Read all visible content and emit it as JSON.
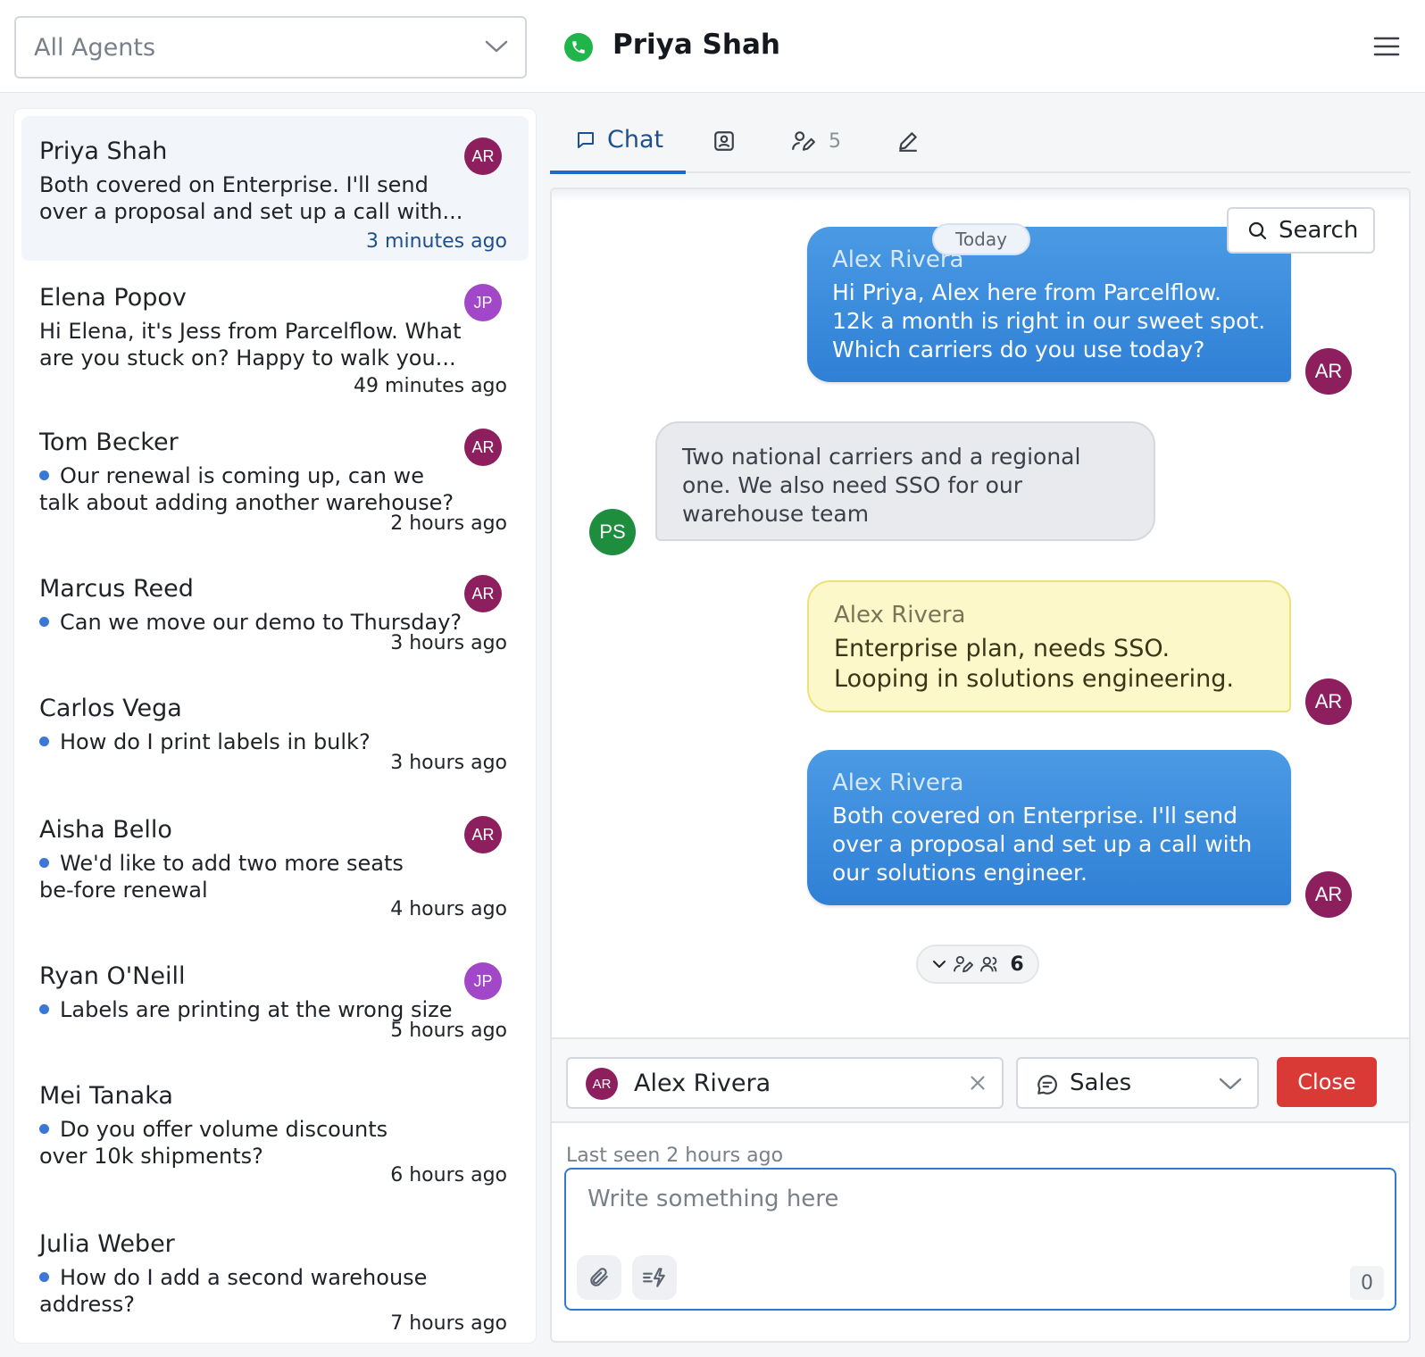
{
  "header": {
    "agent_filter": "All Agents",
    "contact_name": "Priya Shah"
  },
  "conversations": [
    {
      "name": "Priya Shah",
      "preview": "Both covered on Enterprise. I'll send over a proposal and set up a call with...",
      "time": "3 minutes ago",
      "avatar": "AR",
      "unread": false
    },
    {
      "name": "Elena Popov",
      "preview": "Hi Elena, it's Jess from Parcelflow. What are you stuck on? Happy to walk you...",
      "time": "49 minutes ago",
      "avatar": "JP",
      "unread": false
    },
    {
      "name": "Tom Becker",
      "preview": "Our renewal is coming up, can we talk about adding another warehouse?",
      "time": "2 hours ago",
      "avatar": "AR",
      "unread": true
    },
    {
      "name": "Marcus Reed",
      "preview": "Can we move our demo to Thursday?",
      "time": "3 hours ago",
      "avatar": "AR",
      "unread": true
    },
    {
      "name": "Carlos Vega",
      "preview": "How do I print labels in bulk?",
      "time": "3 hours ago",
      "avatar": "",
      "unread": true
    },
    {
      "name": "Aisha Bello",
      "preview": "We'd like to add two more seats be-fore renewal",
      "time": "4 hours ago",
      "avatar": "AR",
      "unread": true
    },
    {
      "name": "Ryan O'Neill",
      "preview": "Labels are printing at the wrong size",
      "time": "5 hours ago",
      "avatar": "JP",
      "unread": true
    },
    {
      "name": "Mei Tanaka",
      "preview": "Do you offer volume discounts over 10k shipments?",
      "time": "6 hours ago",
      "avatar": "",
      "unread": true
    },
    {
      "name": "Julia Weber",
      "preview": "How do I add a second warehouse address?",
      "time": "7 hours ago",
      "avatar": "",
      "unread": true
    }
  ],
  "tabs": {
    "chat_label": "Chat",
    "participants_count": "5"
  },
  "chat": {
    "date_divider": "Today",
    "search_label": "Search",
    "messages": [
      {
        "type": "agent",
        "sender": "Alex Rivera",
        "text": "Hi Priya, Alex here from Parcelflow. 12k a month is right in our sweet spot. Which carriers do you use today?",
        "avatar": "AR"
      },
      {
        "type": "customer",
        "sender": "",
        "text": "Two national carriers and a regional one. We also need SSO for our warehouse team",
        "avatar": "PS"
      },
      {
        "type": "note",
        "sender": "Alex Rivera",
        "text": "Enterprise plan, needs SSO. Looping in solutions engineering.",
        "avatar": "AR"
      },
      {
        "type": "agent",
        "sender": "Alex Rivera",
        "text": "Both covered on Enterprise. I'll send over a proposal and set up a call with our solutions engineer.",
        "avatar": "AR"
      }
    ],
    "events_count": "6"
  },
  "composer": {
    "assignee_name": "Alex Rivera",
    "assignee_initials": "AR",
    "team": "Sales",
    "close_label": "Close",
    "last_seen": "Last seen 2 hours ago",
    "placeholder": "Write something here",
    "char_count": "0"
  },
  "colors": {
    "avatar_ar": "#8e1f5e",
    "avatar_jp": "#a347c9",
    "avatar_ps": "#1e8e3e",
    "accent": "#2367c6",
    "close": "#d93a35"
  }
}
